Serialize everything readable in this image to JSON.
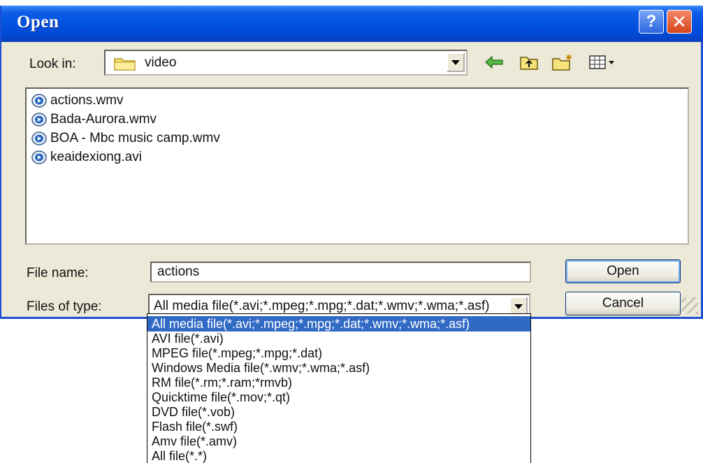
{
  "window": {
    "title": "Open",
    "help_button": "?",
    "close_button": "✕"
  },
  "look_in": {
    "label": "Look in:",
    "value": "video",
    "toolbar": [
      "back-icon",
      "up-folder-icon",
      "new-folder-icon",
      "view-menu-icon"
    ]
  },
  "files": [
    {
      "name": "actions.wmv",
      "icon": "media-file-icon"
    },
    {
      "name": "Bada-Aurora.wmv",
      "icon": "media-file-icon"
    },
    {
      "name": "BOA - Mbc music camp.wmv",
      "icon": "media-file-icon"
    },
    {
      "name": "keaidexiong.avi",
      "icon": "media-file-icon"
    }
  ],
  "file_name": {
    "label": "File name:",
    "value": "actions"
  },
  "file_type": {
    "label": "Files of type:",
    "value": "All media file(*.avi;*.mpeg;*.mpg;*.dat;*.wmv;*.wma;*.asf)",
    "options": [
      "All media file(*.avi;*.mpeg;*.mpg;*.dat;*.wmv;*.wma;*.asf)",
      "AVI file(*.avi)",
      "MPEG file(*.mpeg;*.mpg;*.dat)",
      "Windows Media file(*.wmv;*.wma;*.asf)",
      "RM file(*.rm;*.ram;*rmvb)",
      "Quicktime file(*.mov;*.qt)",
      "DVD file(*.vob)",
      "Flash file(*.swf)",
      "Amv file(*.amv)",
      "All file(*.*)"
    ],
    "selected_index": 0
  },
  "buttons": {
    "open": "Open",
    "cancel": "Cancel"
  },
  "colors": {
    "titlebar": "#0050e0",
    "face": "#ece9d8",
    "selection": "#316ac5"
  }
}
